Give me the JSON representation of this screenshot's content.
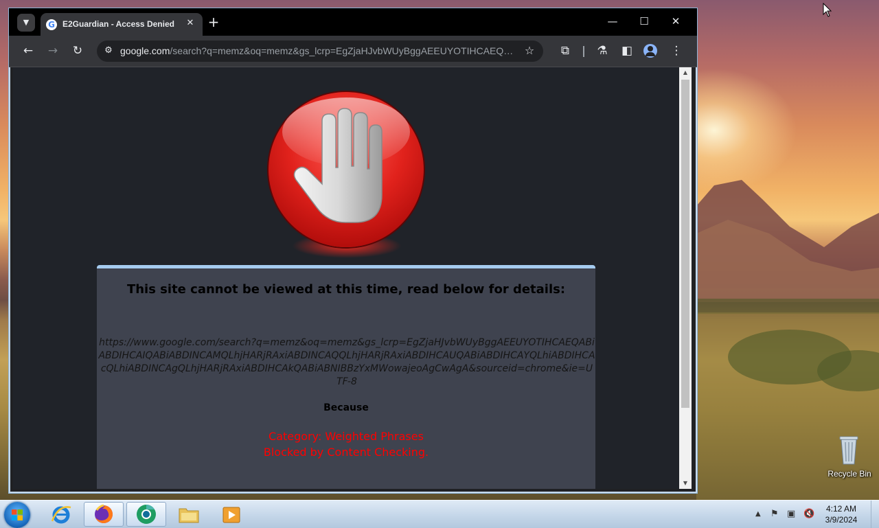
{
  "browser": {
    "tab_title": "E2Guardian - Access Denied",
    "tab_close": "✕",
    "new_tab": "+",
    "url_host": "google.com",
    "url_rest": "/search?q=memz&oq=memz&gs_lcrp=EgZjaHJvbWUyBggAEEUYOTIHCAEQABi...",
    "win_minimize": "—",
    "win_maximize": "☐",
    "win_close": "✕"
  },
  "page": {
    "heading": "This site cannot be viewed at this time, read below for details:",
    "blocked_url": "https://www.google.com/search?q=memz&oq=memz&gs_lcrp=EgZjaHJvbWUyBggAEEUYOTIHCAEQABiABDIHCAIQABiABDINCAMQLhjHARjRAxiABDINCAQQLhjHARjRAxiABDIHCAUQABiABDIHCAYQLhiABDIHCAcQLhiABDINCAgQLhjHARjRAxiABDIHCAkQABiABNIBBzYxMWowajeoAgCwAgA&sourceid=chrome&ie=UTF-8",
    "because": "Because",
    "category": "Category: Weighted Phrases",
    "reason": "Blocked by Content Checking."
  },
  "desktop": {
    "recycle_bin_label": "Recycle Bin"
  },
  "taskbar": {
    "time": "4:12 AM",
    "date": "3/9/2024",
    "items": [
      "internet-explorer",
      "firefox",
      "chrome",
      "file-explorer",
      "media-player"
    ]
  },
  "colors": {
    "accent_panel_border": "#a5cbef",
    "error_red": "#ff0000",
    "page_bg": "#202329",
    "panel_bg": "#3f434f"
  }
}
